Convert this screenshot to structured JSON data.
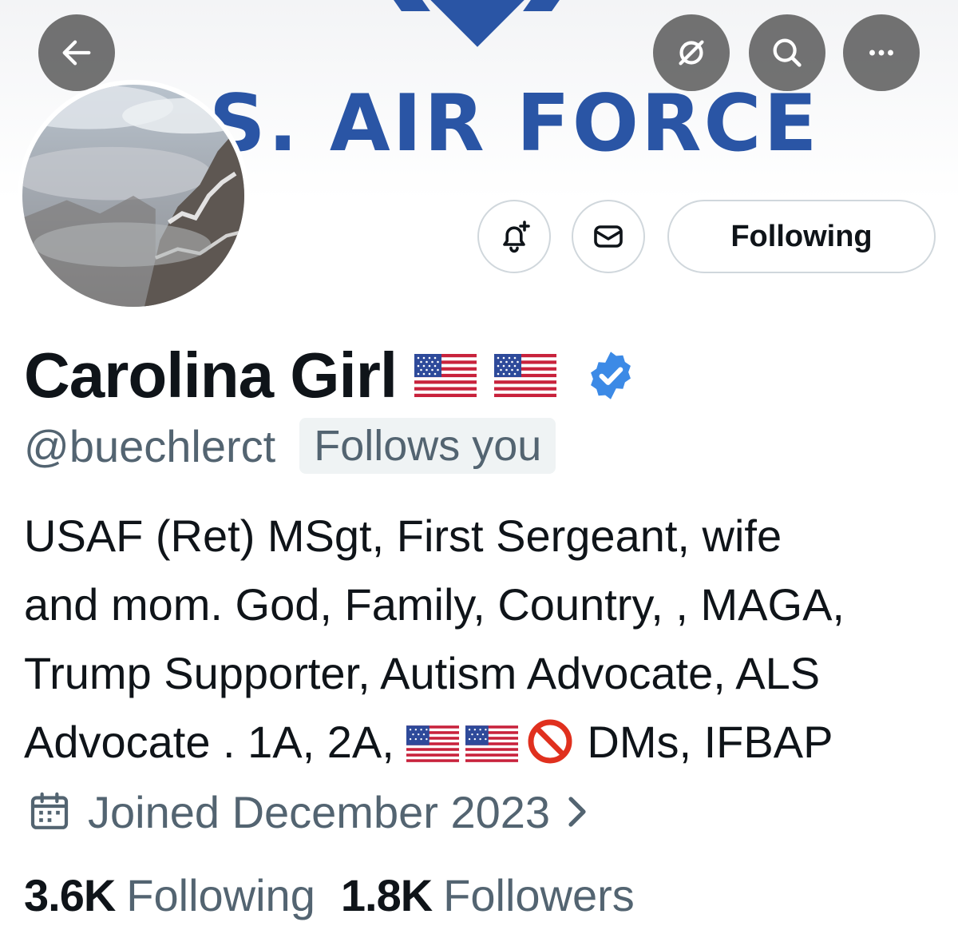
{
  "banner": {
    "text": "S. AIR FORCE"
  },
  "top_bar": {
    "back_icon": "arrow-left-icon",
    "grok_icon": "grok-icon",
    "search_icon": "search-icon",
    "more_icon": "more-icon"
  },
  "actions": {
    "notify_icon": "bell-plus-icon",
    "message_icon": "envelope-icon",
    "following_label": "Following"
  },
  "profile": {
    "display_name": "Carolina Girl",
    "handle": "@buechlerct",
    "follows_you": "Follows you",
    "verified_color": "#3c8ae6",
    "bio_lines": [
      "USAF (Ret) MSgt, First Sergeant, wife",
      "and mom. God, Family, Country, , MAGA,",
      "Trump Supporter, Autism Advocate, ALS",
      "Advocate . 1A, 2A,",
      "DMs, IFBAP"
    ],
    "joined": "Joined December 2023"
  },
  "stats": {
    "following_count": "3.6K",
    "following_label": "Following",
    "followers_count": "1.8K",
    "followers_label": "Followers"
  },
  "colors": {
    "text_primary": "#0f1419",
    "text_secondary": "#536471",
    "banner_blue": "#2a55a5",
    "overlay_button": "#5f5f5f"
  }
}
